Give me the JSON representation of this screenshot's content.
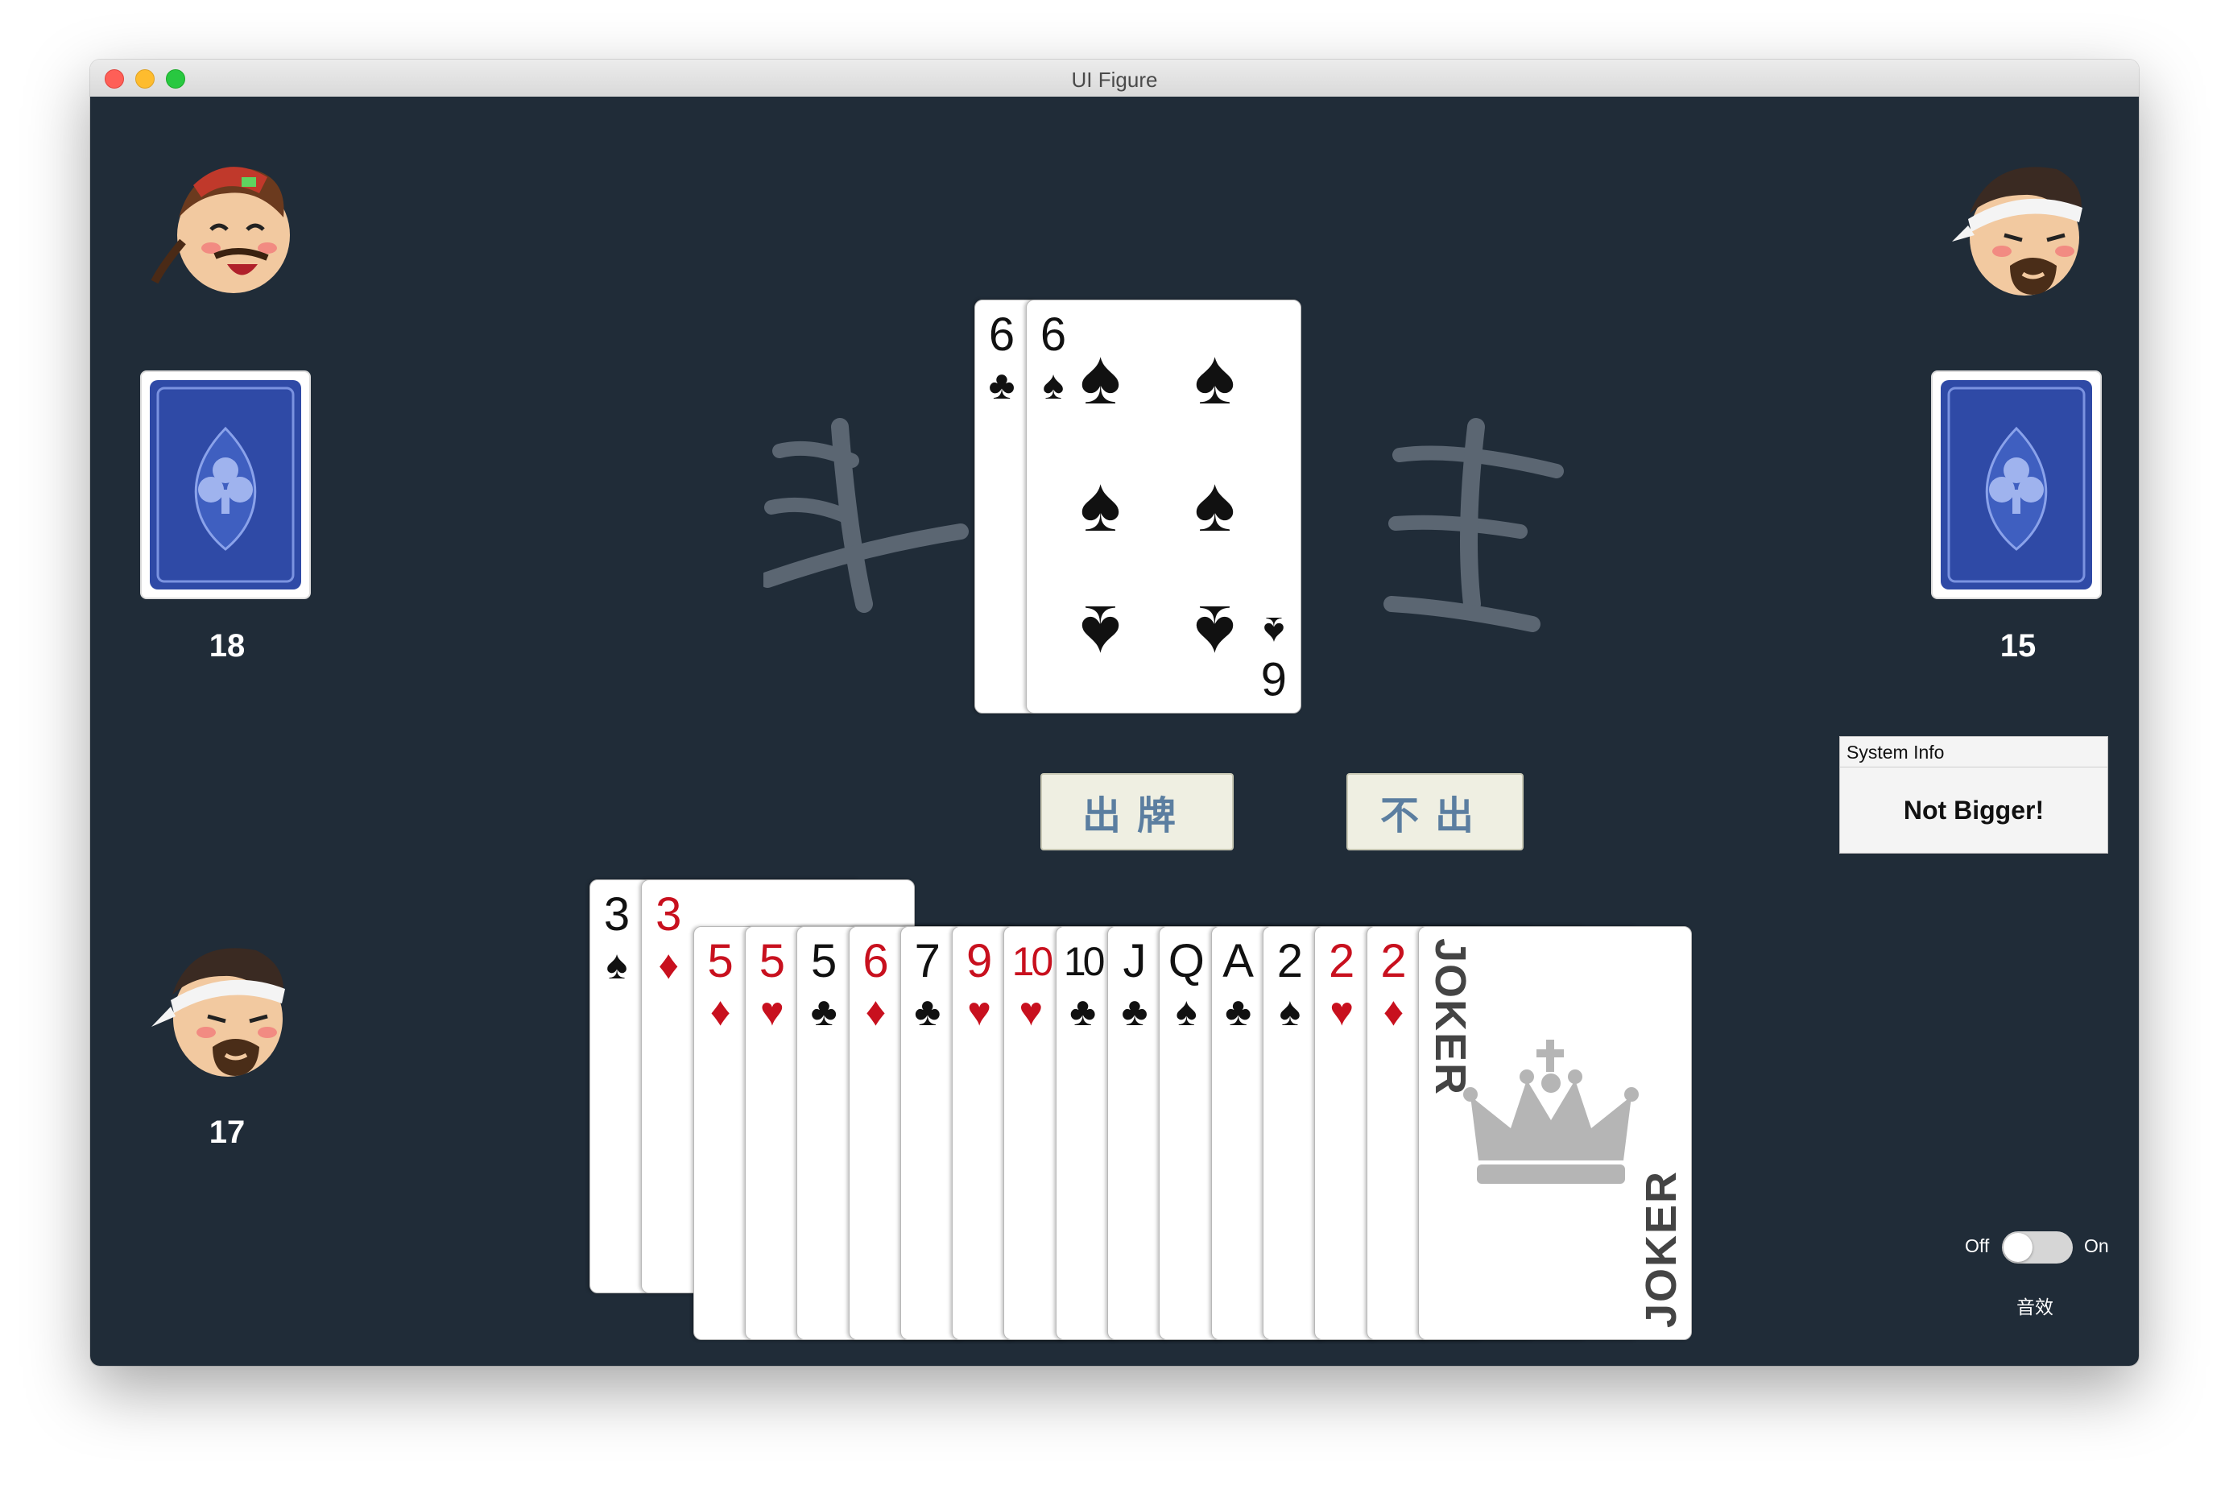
{
  "window": {
    "title": "UI Figure"
  },
  "players": {
    "left_top": {
      "count": "18"
    },
    "right_top": {
      "count": "15"
    },
    "self": {
      "count": "17"
    }
  },
  "table_cards": [
    {
      "rank": "6",
      "suit": "♣",
      "color": "black"
    },
    {
      "rank": "6",
      "suit": "♠",
      "color": "black"
    }
  ],
  "actions": {
    "play_label": "出牌",
    "pass_label": "不出"
  },
  "system_info": {
    "header": "System Info",
    "message": "Not Bigger!"
  },
  "sound": {
    "off_label": "Off",
    "on_label": "On",
    "caption": "音效",
    "enabled": false
  },
  "hand": [
    {
      "rank": "3",
      "suit": "♠",
      "color": "black",
      "raised": true
    },
    {
      "rank": "3",
      "suit": "♦",
      "color": "red",
      "raised": true
    },
    {
      "rank": "5",
      "suit": "♦",
      "color": "red",
      "raised": false
    },
    {
      "rank": "5",
      "suit": "♥",
      "color": "red",
      "raised": false
    },
    {
      "rank": "5",
      "suit": "♣",
      "color": "black",
      "raised": false
    },
    {
      "rank": "6",
      "suit": "♦",
      "color": "red",
      "raised": false
    },
    {
      "rank": "7",
      "suit": "♣",
      "color": "black",
      "raised": false
    },
    {
      "rank": "9",
      "suit": "♥",
      "color": "red",
      "raised": false
    },
    {
      "rank": "10",
      "suit": "♥",
      "color": "red",
      "raised": false
    },
    {
      "rank": "10",
      "suit": "♣",
      "color": "black",
      "raised": false
    },
    {
      "rank": "J",
      "suit": "♣",
      "color": "black",
      "raised": false
    },
    {
      "rank": "Q",
      "suit": "♠",
      "color": "black",
      "raised": false
    },
    {
      "rank": "A",
      "suit": "♣",
      "color": "black",
      "raised": false
    },
    {
      "rank": "2",
      "suit": "♠",
      "color": "black",
      "raised": false
    },
    {
      "rank": "2",
      "suit": "♥",
      "color": "red",
      "raised": false
    },
    {
      "rank": "2",
      "suit": "♦",
      "color": "red",
      "raised": false
    },
    {
      "rank": "JOKER",
      "suit": "",
      "color": "gray",
      "raised": false
    }
  ],
  "colors": {
    "table": "#202c38",
    "button_bg": "#efefe2",
    "button_text": "#5b7ea0",
    "red_suit": "#c8101e"
  }
}
